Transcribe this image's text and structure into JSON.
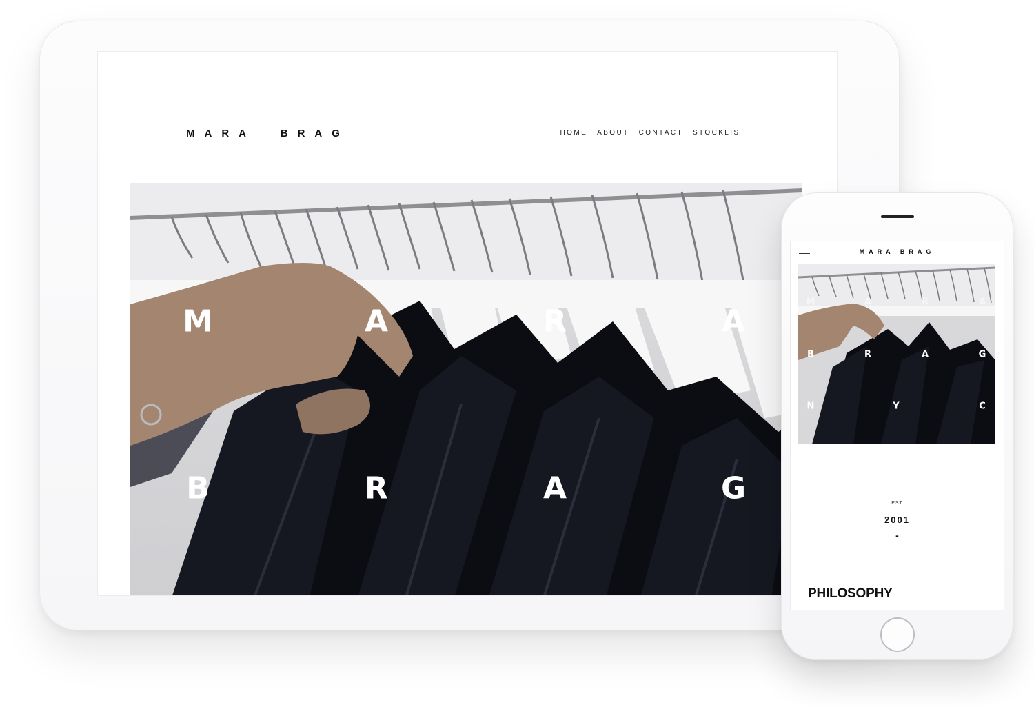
{
  "tablet": {
    "logo": "MARA  BRAG",
    "nav": [
      "HOME",
      "ABOUT",
      "CONTACT",
      "STOCKLIST"
    ],
    "hero_letters": [
      "M",
      "A",
      "R",
      "A",
      "B",
      "R",
      "A",
      "G"
    ]
  },
  "phone": {
    "menu_icon": "hamburger-icon",
    "logo": "MARA BRAG",
    "hero_letters": [
      "M",
      "A",
      "R",
      "A",
      "B",
      "R",
      "A",
      "G",
      "N",
      "Y",
      "C"
    ],
    "est_label": "EST",
    "year": "2001",
    "dash": "-",
    "section_heading": "PHILOSOPHY"
  }
}
